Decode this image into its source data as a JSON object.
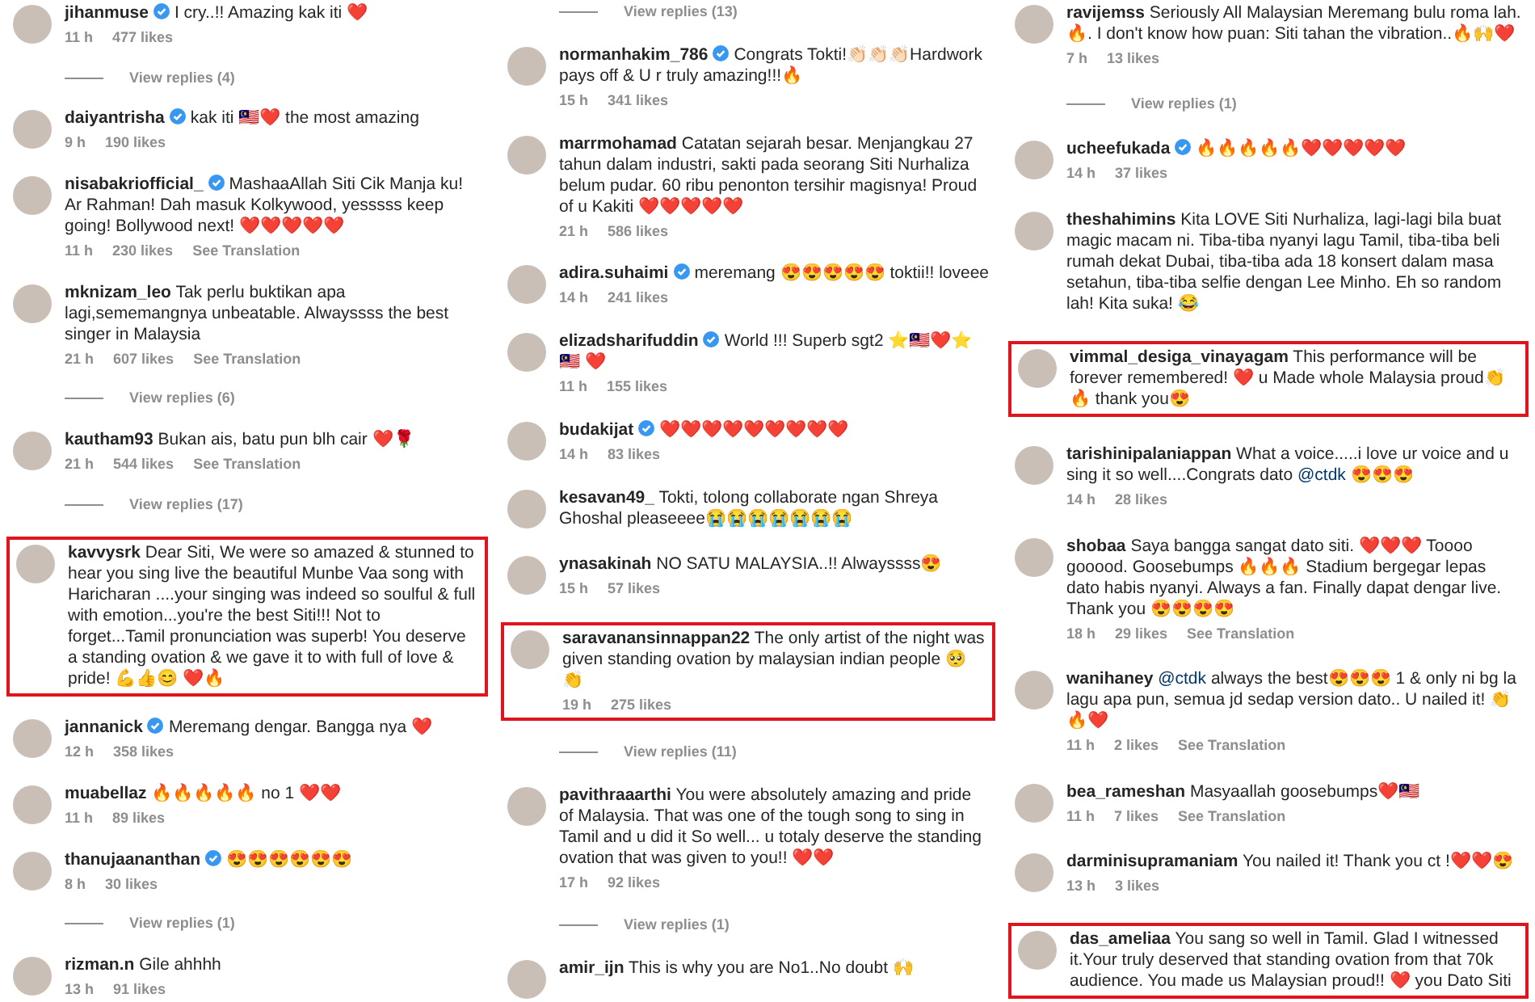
{
  "columns": [
    {
      "items": [
        {
          "kind": "comment",
          "user": "jihanmuse",
          "verified": true,
          "text": "I cry..!! Amazing kak iti ❤️",
          "time": "11 h",
          "likes": "477 likes",
          "highlighted": false
        },
        {
          "kind": "view_replies",
          "label": "View replies (4)"
        },
        {
          "kind": "comment",
          "user": "daiyantrisha",
          "verified": true,
          "text": "kak iti 🇲🇾❤️ the most amazing",
          "time": "9 h",
          "likes": "190 likes",
          "highlighted": false
        },
        {
          "kind": "comment",
          "user": "nisabakriofficial_",
          "verified": true,
          "text": "MashaaAllah Siti Cik Manja ku! Ar Rahman! Dah masuk Kolkywood, yesssss keep going! Bollywood next! ❤️❤️❤️❤️❤️",
          "time": "11 h",
          "likes": "230 likes",
          "translation": "See Translation",
          "highlighted": false
        },
        {
          "kind": "comment",
          "user": "mknizam_leo",
          "verified": false,
          "text": "Tak perlu buktikan apa lagi,sememangnya unbeatable. Alwayssss the best singer in Malaysia",
          "time": "21 h",
          "likes": "607 likes",
          "translation": "See Translation",
          "highlighted": false
        },
        {
          "kind": "view_replies",
          "label": "View replies (6)"
        },
        {
          "kind": "comment",
          "user": "kautham93",
          "verified": false,
          "text": "Bukan ais, batu pun blh cair ❤️🌹",
          "time": "21 h",
          "likes": "544 likes",
          "translation": "See Translation",
          "highlighted": false
        },
        {
          "kind": "view_replies",
          "label": "View replies (17)"
        },
        {
          "kind": "comment",
          "user": "kavvysrk",
          "verified": false,
          "text": "Dear Siti, We were so amazed & stunned to hear you sing live the beautiful Munbe Vaa song with Haricharan ....your singing was indeed so soulful & full with emotion...you're the best Siti!!! Not to forget...Tamil pronunciation was superb! You deserve a standing ovation & we gave it to with full of love & pride! 💪👍😊 ❤️🔥",
          "highlighted": true
        },
        {
          "kind": "comment",
          "user": "jannanick",
          "verified": true,
          "text": "Meremang dengar. Bangga nya ❤️",
          "time": "12 h",
          "likes": "358 likes",
          "highlighted": false
        },
        {
          "kind": "comment",
          "user": "muabellaz",
          "verified": false,
          "text": "🔥🔥🔥🔥🔥 no 1 ❤️❤️",
          "time": "11 h",
          "likes": "89 likes",
          "highlighted": false
        },
        {
          "kind": "comment",
          "user": "thanujaananthan",
          "verified": true,
          "text": "😍😍😍😍😍😍",
          "time": "8 h",
          "likes": "30 likes",
          "highlighted": false
        },
        {
          "kind": "view_replies",
          "label": "View replies (1)"
        },
        {
          "kind": "comment",
          "user": "rizman.n",
          "verified": false,
          "text": "Gile ahhhh",
          "time": "13 h",
          "likes": "91 likes",
          "highlighted": false
        }
      ]
    },
    {
      "items": [
        {
          "kind": "view_replies",
          "label": "View replies (13)"
        },
        {
          "kind": "comment",
          "user": "normanhakim_786",
          "verified": true,
          "text": "Congrats Tokti!👏🏻👏🏻👏🏻Hardwork pays off & U r truly amazing!!!🔥",
          "time": "15 h",
          "likes": "341 likes",
          "highlighted": false
        },
        {
          "kind": "comment",
          "user": "marrmohamad",
          "verified": false,
          "text": "Catatan sejarah besar. Menjangkau 27 tahun dalam industri, sakti pada seorang Siti Nurhaliza belum pudar. 60 ribu penonton tersihir magisnya! Proud of u Kakiti ❤️❤️❤️❤️❤️",
          "time": "21 h",
          "likes": "586 likes",
          "highlighted": false
        },
        {
          "kind": "comment",
          "user": "adira.suhaimi",
          "verified": true,
          "text": "meremang 😍😍😍😍😍 toktii!! loveee",
          "time": "14 h",
          "likes": "241 likes",
          "highlighted": false
        },
        {
          "kind": "comment",
          "user": "elizadsharifuddin",
          "verified": true,
          "text": "World !!! Superb sgt2 ⭐🇲🇾❤️⭐🇲🇾 ❤️",
          "time": "11 h",
          "likes": "155 likes",
          "highlighted": false
        },
        {
          "kind": "comment",
          "user": "budakijat",
          "verified": true,
          "text": "❤️❤️❤️❤️❤️❤️❤️❤️❤️",
          "time": "14 h",
          "likes": "83 likes",
          "highlighted": false
        },
        {
          "kind": "comment",
          "user": "kesavan49_",
          "verified": false,
          "text": "Tokti, tolong collaborate ngan Shreya Ghoshal pleaseeee😭😭😭😭😭😭😭",
          "highlighted": false
        },
        {
          "kind": "comment",
          "user": "ynasakinah",
          "verified": false,
          "text": "NO SATU MALAYSIA..!! Alwayssss😍",
          "time": "15 h",
          "likes": "57 likes",
          "highlighted": false
        },
        {
          "kind": "comment",
          "user": "saravanansinnappan22",
          "verified": false,
          "text": "The only artist of the night was given standing ovation by malaysian indian people 🥺👏",
          "time": "19 h",
          "likes": "275 likes",
          "highlighted": true
        },
        {
          "kind": "view_replies",
          "label": "View replies (11)"
        },
        {
          "kind": "comment",
          "user": "pavithraaarthi",
          "verified": false,
          "text": "You were absolutely amazing and pride of Malaysia. That was one of the tough song to sing in Tamil and u did it So well... u totaly deserve the standing ovation that was given to you!! ❤️❤️",
          "time": "17 h",
          "likes": "92 likes",
          "highlighted": false
        },
        {
          "kind": "view_replies",
          "label": "View replies (1)"
        },
        {
          "kind": "comment",
          "user": "amir_ijn",
          "verified": false,
          "text": "This is why you are No1..No doubt 🙌",
          "highlighted": false
        }
      ]
    },
    {
      "items": [
        {
          "kind": "comment",
          "user": "ravijemss",
          "verified": false,
          "text": "Seriously All Malaysian Meremang bulu roma lah. 🔥. I don't know how puan: Siti tahan the vibration..🔥🙌❤️",
          "time": "7 h",
          "likes": "13 likes",
          "highlighted": false
        },
        {
          "kind": "view_replies",
          "label": "View replies (1)"
        },
        {
          "kind": "comment",
          "user": "ucheefukada",
          "verified": true,
          "text": "🔥🔥🔥🔥🔥❤️❤️❤️❤️❤️",
          "time": "14 h",
          "likes": "37 likes",
          "highlighted": false
        },
        {
          "kind": "comment",
          "user": "theshahimins",
          "verified": false,
          "text": "Kita LOVE Siti Nurhaliza, lagi-lagi bila buat magic macam ni. Tiba-tiba nyanyi lagu Tamil, tiba-tiba beli rumah dekat Dubai, tiba-tiba ada 18 konsert dalam masa setahun, tiba-tiba selfie dengan Lee Minho. Eh so random lah! Kita suka! 😂",
          "highlighted": false
        },
        {
          "kind": "comment",
          "user": "vimmal_desiga_vinayagam",
          "verified": false,
          "text": "This performance will be forever remembered! ❤️ u Made whole Malaysia proud👏🔥 thank you😍",
          "highlighted": true
        },
        {
          "kind": "comment",
          "user": "tarishinipalaniappan",
          "verified": false,
          "parts": [
            {
              "kind": "text",
              "text": "What a voice.....i love ur voice and u sing it so well....Congrats dato "
            },
            {
              "kind": "mention",
              "text": "@ctdk"
            },
            {
              "kind": "text",
              "text": " 😍😍😍"
            }
          ],
          "time": "14 h",
          "likes": "28 likes",
          "highlighted": false
        },
        {
          "kind": "comment",
          "user": "shobaa",
          "verified": false,
          "text": "Saya bangga sangat dato siti. ❤️❤️❤️ Toooo gooood. Goosebumps 🔥🔥🔥 Stadium bergegar lepas dato habis nyanyi. Always a fan. Finally dapat dengar live. Thank you 😍😍😍😍",
          "time": "18 h",
          "likes": "29 likes",
          "translation": "See Translation",
          "highlighted": false
        },
        {
          "kind": "comment",
          "user": "wanihaney",
          "verified": false,
          "parts": [
            {
              "kind": "mention",
              "text": "@ctdk"
            },
            {
              "kind": "text",
              "text": " always the best😍😍😍 1 & only ni bg la lagu apa pun, semua jd sedap version dato.. U nailed it! 👏🔥❤️"
            }
          ],
          "time": "11 h",
          "likes": "2 likes",
          "translation": "See Translation",
          "highlighted": false
        },
        {
          "kind": "comment",
          "user": "bea_rameshan",
          "verified": false,
          "text": "Masyaallah goosebumps❤️🇲🇾",
          "time": "11 h",
          "likes": "7 likes",
          "translation": "See Translation",
          "highlighted": false
        },
        {
          "kind": "comment",
          "user": "darminisupramaniam",
          "verified": false,
          "text": "You nailed it! Thank you ct !❤️❤️😍",
          "time": "13 h",
          "likes": "3 likes",
          "highlighted": false
        },
        {
          "kind": "comment",
          "user": "das_ameliaa",
          "verified": false,
          "text": "You sang so well in Tamil. Glad I witnessed it.Your truly deserved that standing ovation from that 70k audience. You made us Malaysian proud!! ❤️ you Dato Siti",
          "highlighted": true
        }
      ]
    }
  ]
}
